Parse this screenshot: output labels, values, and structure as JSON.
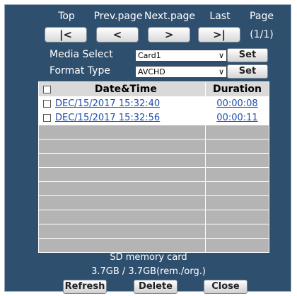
{
  "nav": {
    "labels": [
      "Top",
      "Prev.page",
      "Next.page",
      "Last",
      "Page"
    ],
    "buttons": [
      "|<",
      "<",
      ">",
      ">|"
    ],
    "page_count": "(1/1)"
  },
  "media": {
    "label": "Media Select",
    "value": "Card1",
    "set": "Set"
  },
  "format": {
    "label": "Format Type",
    "value": "AVCHD",
    "set": "Set"
  },
  "table": {
    "headers": [
      "Date&Time",
      "Duration"
    ],
    "rows": [
      {
        "date": "DEC/15/2017 15:32:40",
        "duration": "00:00:08"
      },
      {
        "date": "DEC/15/2017 15:32:56",
        "duration": "00:00:11"
      }
    ],
    "empty_rows": 9
  },
  "storage": {
    "title": "SD memory card",
    "value": "3.7GB / 3.7GB(rem./org.)"
  },
  "actions": {
    "refresh": "Refresh",
    "delete": "Delete",
    "close": "Close"
  }
}
